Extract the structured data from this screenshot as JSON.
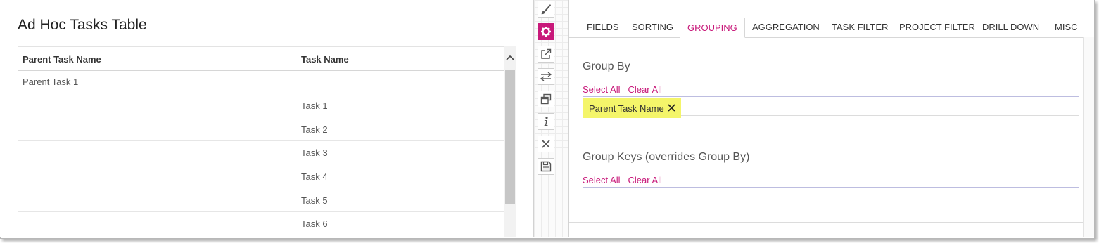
{
  "left_panel": {
    "title": "Ad Hoc Tasks Table",
    "columns": [
      "Parent Task Name",
      "Task Name"
    ],
    "rows": [
      {
        "parent": "Parent Task 1",
        "task": ""
      },
      {
        "parent": "",
        "task": "Task 1"
      },
      {
        "parent": "",
        "task": "Task 2"
      },
      {
        "parent": "",
        "task": "Task 3"
      },
      {
        "parent": "",
        "task": "Task 4"
      },
      {
        "parent": "",
        "task": "Task 5"
      },
      {
        "parent": "",
        "task": "Task 6"
      }
    ]
  },
  "toolbar": {
    "icons": [
      "paintbrush-icon",
      "gear-icon",
      "external-link-icon",
      "swap-arrows-icon",
      "windows-icon",
      "info-icon",
      "close-icon",
      "save-icon"
    ],
    "active": "gear-icon"
  },
  "settings": {
    "tabs": [
      "FIELDS",
      "SORTING",
      "GROUPING",
      "AGGREGATION",
      "TASK FILTER",
      "PROJECT FILTER",
      "DRILL DOWN",
      "MISC"
    ],
    "active_tab": "GROUPING",
    "group_by": {
      "title": "Group By",
      "select_all": "Select All",
      "clear_all": "Clear All",
      "selected": [
        "Parent Task Name"
      ]
    },
    "group_keys": {
      "title": "Group Keys (overrides Group By)",
      "select_all": "Select All",
      "clear_all": "Clear All",
      "selected": []
    }
  },
  "colors": {
    "accent": "#c8197a",
    "highlight": "#f4f56a"
  }
}
